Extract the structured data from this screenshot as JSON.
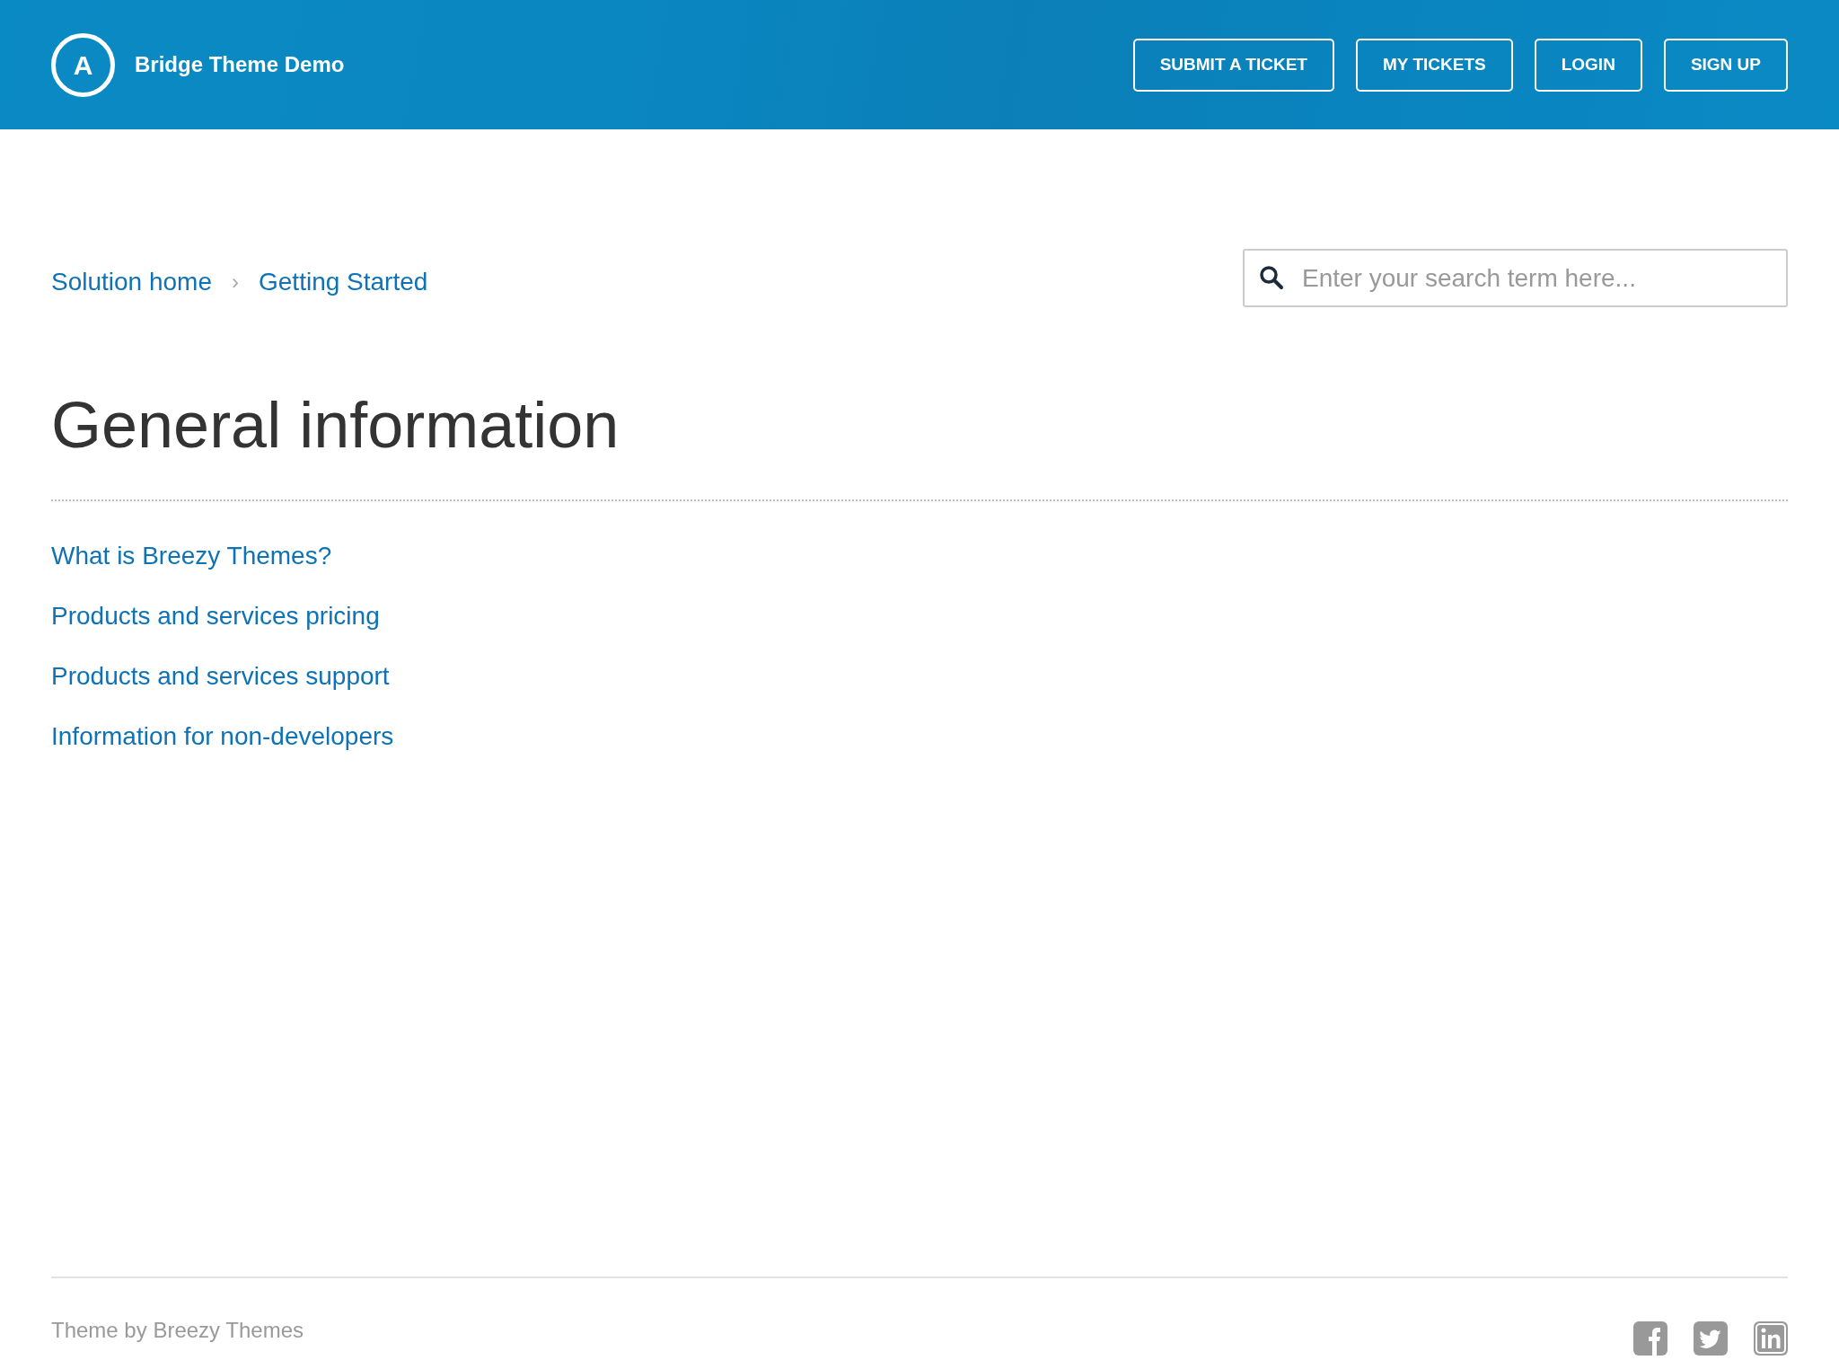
{
  "header": {
    "logo_letter": "A",
    "title": "Bridge Theme Demo",
    "buttons": [
      "SUBMIT A TICKET",
      "MY TICKETS",
      "LOGIN",
      "SIGN UP"
    ]
  },
  "breadcrumb": [
    {
      "label": "Solution home"
    },
    {
      "label": "Getting Started"
    }
  ],
  "breadcrumb_separator": "›",
  "search": {
    "placeholder": "Enter your search term here..."
  },
  "heading": "General information",
  "articles": [
    "What is Breezy Themes?",
    "Products and services pricing",
    "Products and services support",
    "Information for non-developers"
  ],
  "footer": {
    "text": "Theme by Breezy Themes",
    "social": [
      {
        "kind": "facebook"
      },
      {
        "kind": "twitter"
      },
      {
        "kind": "linkedin"
      }
    ]
  }
}
